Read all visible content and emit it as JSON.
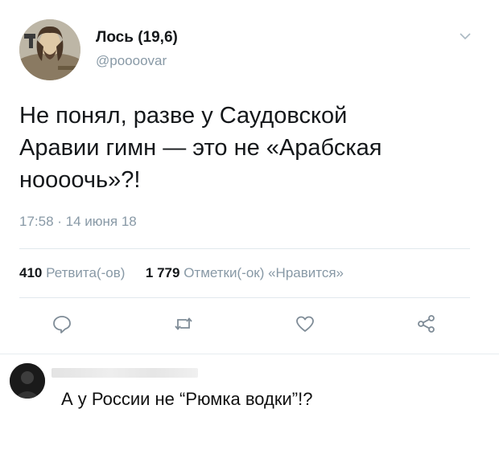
{
  "tweet": {
    "author": {
      "name": "Лось (19,6)",
      "handle": "@poooovar",
      "avatar_icon": "user-avatar-icon"
    },
    "text": "Не понял, разве у Саудовской\nАравии гимн — это не «Арабская\nноооочь»?!",
    "timestamp": "17:58 · 14 июня 18",
    "stats": {
      "retweets_count": "410",
      "retweets_label": "Ретвита(-ов)",
      "likes_count": "1 779",
      "likes_label": "Отметки(-ок) «Нравится»"
    },
    "actions": [
      "reply-icon",
      "retweet-icon",
      "like-icon",
      "share-icon"
    ],
    "menu_icon": "chevron-down-icon"
  },
  "comment": {
    "avatar_icon": "user-avatar-icon",
    "text": "А у России не “Рюмка водки”!?"
  },
  "colors": {
    "text_primary": "#14171a",
    "text_secondary": "#8899a6",
    "divider": "#e1e8ed"
  }
}
